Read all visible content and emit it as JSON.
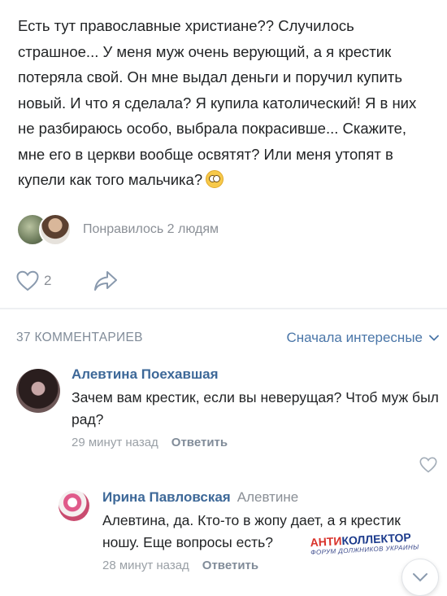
{
  "post": {
    "text": "Есть тут православные христиане?? Случилось страшное... У меня муж очень верующий, а я крестик потеряла свой. Он мне выдал деньги и поручил купить новый. И что я сделала? Я купила католический! Я в них не разбираюсь особо, выбрала покрасивше... Скажите, мне его в церкви вообще освятят? Или меня утопят в купели как того мальчика?",
    "emoji": "flushed-face-icon",
    "likes_text": "Понравилось 2 людям",
    "like_count": "2"
  },
  "comments_section": {
    "count_label": "37 КОММЕНТАРИЕВ",
    "sort_label": "Сначала интересные"
  },
  "comments": [
    {
      "author": "Алевтина Поехавшая",
      "reply_to": "",
      "text": "Зачем вам крестик, если вы неверущая? Чтоб муж был рад?",
      "time": "29 минут назад",
      "reply_label": "Ответить"
    },
    {
      "author": "Ирина Павловская",
      "reply_to": "Алевтине",
      "text": "Алевтина, да. Кто-то в жопу дает, а я крестик ношу. Еще вопросы есть?",
      "time": "28 минут назад",
      "reply_label": "Ответить"
    }
  ],
  "watermark": {
    "logo_a": "АНТИ",
    "logo_b": "КОЛЛЕКТОР",
    "subtitle": "ФОРУМ ДОЛЖНИКОВ УКРАИНЫ"
  },
  "colors": {
    "link": "#4a76a8",
    "author": "#3d6898",
    "muted": "#8a8f96"
  }
}
